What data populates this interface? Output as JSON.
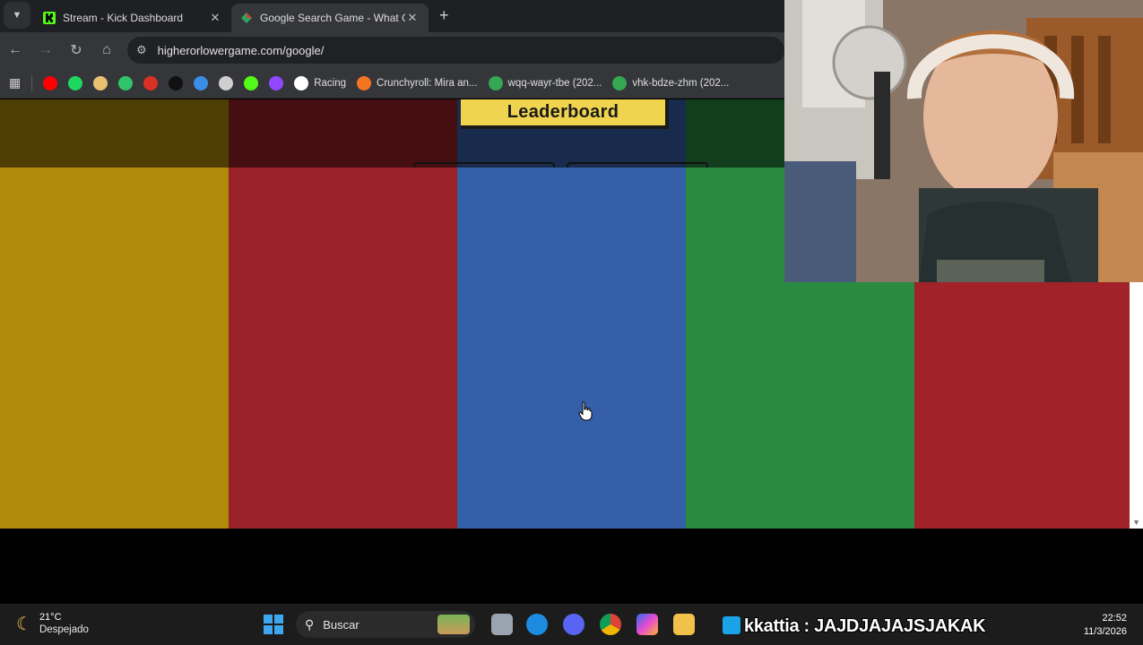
{
  "browser": {
    "tabs": [
      {
        "title": "Stream - Kick Dashboard",
        "active": false
      },
      {
        "title": "Google Search Game - What Gets",
        "active": true
      }
    ],
    "new_tab": "+",
    "close": "✕",
    "address": "higherorlowergame.com/google/",
    "bookmarks": [
      {
        "icon": "youtube-icon",
        "color": "#ff0000",
        "label": ""
      },
      {
        "icon": "spotify-icon",
        "color": "#1ed760",
        "label": ""
      },
      {
        "icon": "bookmark-icon-3",
        "color": "#e8c170",
        "label": ""
      },
      {
        "icon": "bookmark-icon-4",
        "color": "#31c46b",
        "label": ""
      },
      {
        "icon": "gmail-icon",
        "color": "#d93025",
        "label": ""
      },
      {
        "icon": "bookmark-icon-6",
        "color": "#111111",
        "label": ""
      },
      {
        "icon": "bookmark-icon-7",
        "color": "#3a8ee6",
        "label": ""
      },
      {
        "icon": "bookmark-icon-8",
        "color": "#cfcfcf",
        "label": ""
      },
      {
        "icon": "kick-icon",
        "color": "#53fc18",
        "label": ""
      },
      {
        "icon": "twitch-icon",
        "color": "#9146ff",
        "label": ""
      },
      {
        "icon": "google-icon",
        "color": "#ffffff",
        "label": "Racing"
      },
      {
        "icon": "crunchyroll-icon",
        "color": "#f47521",
        "label": "Crunchyroll: Mira an..."
      },
      {
        "icon": "drive-icon",
        "color": "#34a853",
        "label": "wqq-wayr-tbe (202..."
      },
      {
        "icon": "drive-icon-2",
        "color": "#34a853",
        "label": "vhk-bdze-zhm (202..."
      }
    ]
  },
  "page": {
    "leaderboard_label": "Leaderboard",
    "columns": [
      {
        "name": "yellow-column",
        "color": "#b08a0a"
      },
      {
        "name": "red-column",
        "color": "#9a2228"
      },
      {
        "name": "blue-column",
        "color": "#355fa8"
      },
      {
        "name": "green-column",
        "color": "#2a8a40"
      },
      {
        "name": "red-column-2",
        "color": "#a12228"
      }
    ]
  },
  "taskbar": {
    "weather_temp": "21°C",
    "weather_cond": "Despejado",
    "search_placeholder": "Buscar",
    "chat_message": "kkattia : JAJDJAJAJSJAKAK",
    "time": "22:52",
    "date": "11/3/2026"
  }
}
